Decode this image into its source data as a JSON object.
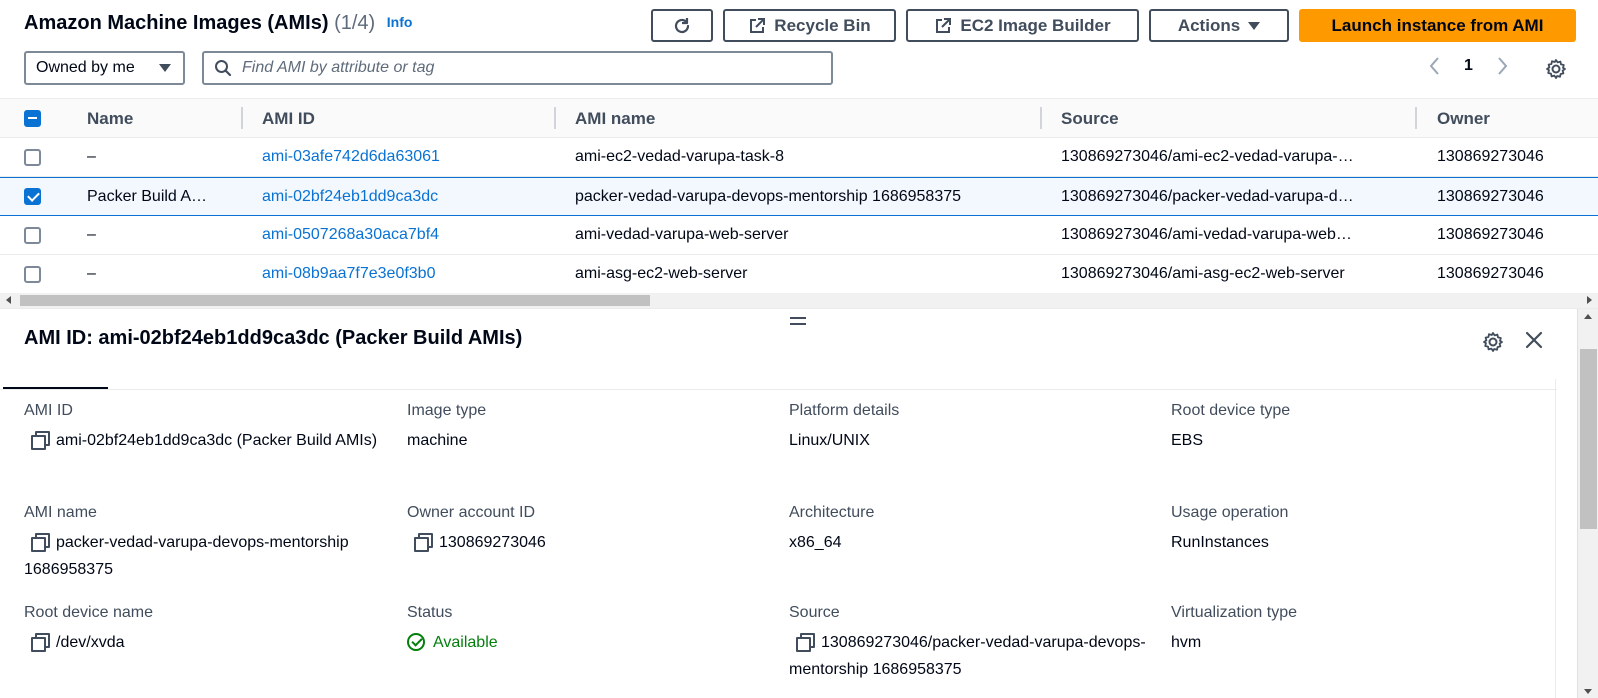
{
  "header": {
    "title": "Amazon Machine Images (AMIs)",
    "count": "(1/4)",
    "info_label": "Info",
    "recycle_bin_label": "Recycle Bin",
    "image_builder_label": "EC2 Image Builder",
    "actions_label": "Actions",
    "launch_label": "Launch instance from AMI"
  },
  "filter": {
    "owner_selected": "Owned by me",
    "search_placeholder": "Find AMI by attribute or tag"
  },
  "pagination": {
    "current_page": "1"
  },
  "table": {
    "columns": [
      "Name",
      "AMI ID",
      "AMI name",
      "Source",
      "Owner"
    ],
    "rows": [
      {
        "selected": false,
        "name": "–",
        "ami_id": "ami-03afe742d6da63061",
        "ami_name": "ami-ec2-vedad-varupa-task-8",
        "source": "130869273046/ami-ec2-vedad-varupa-…",
        "owner": "130869273046"
      },
      {
        "selected": true,
        "name": "Packer Build A…",
        "ami_id": "ami-02bf24eb1dd9ca3dc",
        "ami_name": "packer-vedad-varupa-devops-mentorship 1686958375",
        "source": "130869273046/packer-vedad-varupa-d…",
        "owner": "130869273046"
      },
      {
        "selected": false,
        "name": "–",
        "ami_id": "ami-0507268a30aca7bf4",
        "ami_name": "ami-vedad-varupa-web-server",
        "source": "130869273046/ami-vedad-varupa-web…",
        "owner": "130869273046"
      },
      {
        "selected": false,
        "name": "–",
        "ami_id": "ami-08b9aa7f7e3e0f3b0",
        "ami_name": "ami-asg-ec2-web-server",
        "source": "130869273046/ami-asg-ec2-web-server",
        "owner": "130869273046"
      }
    ]
  },
  "details": {
    "title": "AMI ID: ami-02bf24eb1dd9ca3dc (Packer Build AMIs)",
    "fields": [
      {
        "label": "AMI ID",
        "value": "ami-02bf24eb1dd9ca3dc (Packer Build AMIs)"
      },
      {
        "label": "Image type",
        "value": "machine"
      },
      {
        "label": "Platform details",
        "value": "Linux/UNIX"
      },
      {
        "label": "Root device type",
        "value": "EBS"
      },
      {
        "label": "AMI name",
        "value": "packer-vedad-varupa-devops-mentorship 1686958375"
      },
      {
        "label": "Owner account ID",
        "value": "130869273046"
      },
      {
        "label": "Architecture",
        "value": "x86_64"
      },
      {
        "label": "Usage operation",
        "value": "RunInstances"
      },
      {
        "label": "Root device name",
        "value": "/dev/xvda"
      },
      {
        "label": "Status",
        "value": "Available"
      },
      {
        "label": "Source",
        "value": "130869273046/packer-vedad-varupa-devops-mentorship 1686958375"
      },
      {
        "label": "Virtualization type",
        "value": "hvm"
      }
    ]
  },
  "colors": {
    "accent": "#0972d3",
    "primary_button": "#ff9900",
    "success": "#037f0c",
    "text": "#000716"
  },
  "icons": [
    "refresh-icon",
    "external-link-icon",
    "caret-down-icon",
    "search-icon",
    "chevron-left-icon",
    "chevron-right-icon",
    "gear-icon",
    "copy-icon",
    "status-ok-icon",
    "close-icon",
    "drag-handle-icon"
  ]
}
